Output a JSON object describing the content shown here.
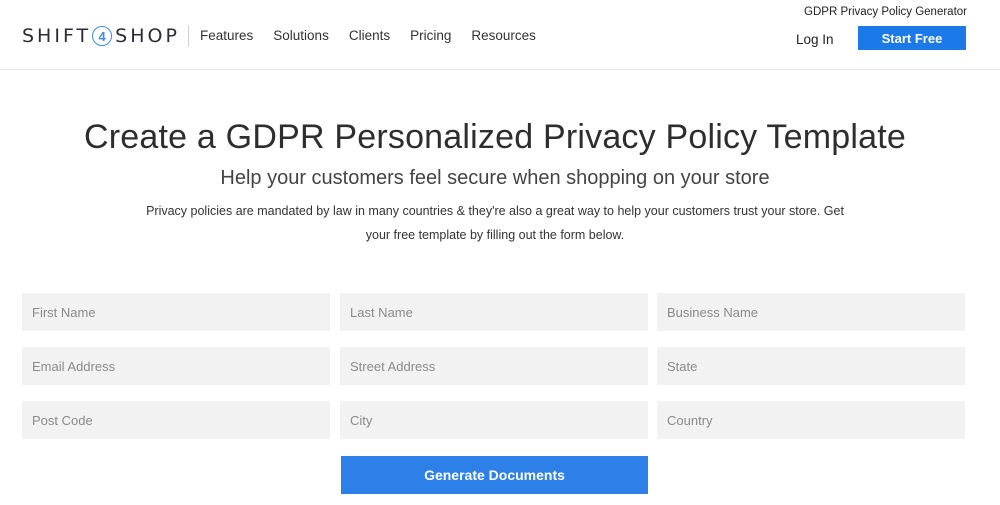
{
  "header": {
    "logo": {
      "left": "SHIFT",
      "middle": "4",
      "right": "SHOP"
    },
    "nav": [
      "Features",
      "Solutions",
      "Clients",
      "Pricing",
      "Resources"
    ],
    "top_link": "GDPR Privacy Policy Generator",
    "login": "Log In",
    "start": "Start Free",
    "accent": "#1c7ae8"
  },
  "hero": {
    "title": "Create a GDPR Personalized Privacy Policy Template",
    "subtitle": "Help your customers feel secure when shopping on your store",
    "desc_line1": "Privacy policies are mandated by law in many countries & they're also a great way to help your customers trust your store. Get",
    "desc_line2": "your free template by filling out the form below."
  },
  "form": {
    "fields": [
      {
        "placeholder": "First Name",
        "value": ""
      },
      {
        "placeholder": "Last Name",
        "value": ""
      },
      {
        "placeholder": "Business Name",
        "value": ""
      },
      {
        "placeholder": "Email Address",
        "value": ""
      },
      {
        "placeholder": "Street Address",
        "value": ""
      },
      {
        "placeholder": "State",
        "value": ""
      },
      {
        "placeholder": "Post Code",
        "value": ""
      },
      {
        "placeholder": "City",
        "value": ""
      },
      {
        "placeholder": "Country",
        "value": ""
      }
    ],
    "submit": "Generate Documents"
  }
}
